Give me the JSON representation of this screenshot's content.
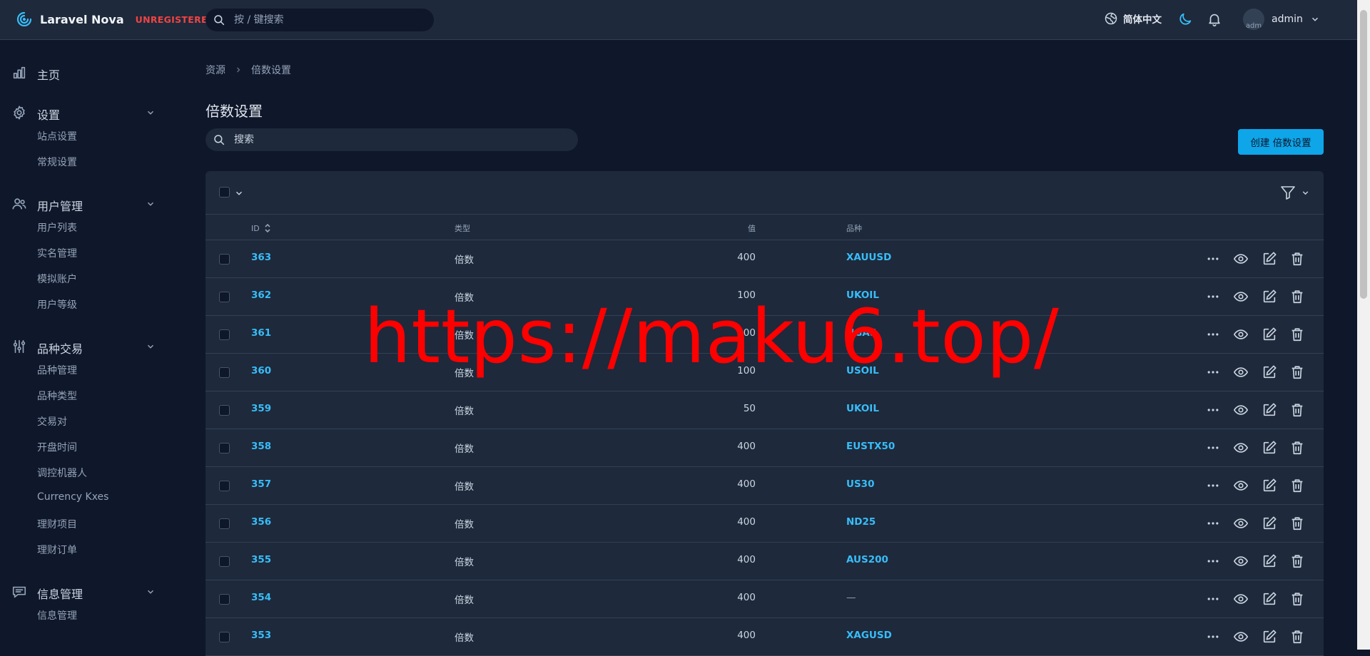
{
  "header": {
    "app_name": "Laravel Nova",
    "license_tag": "UNREGISTERED",
    "search_placeholder": "按 / 键搜索",
    "language": "简体中文",
    "user_name": "admin",
    "avatar_alt": "adm"
  },
  "sidebar": {
    "groups": [
      {
        "label": "主页",
        "icon": "chart-bar-icon",
        "items": []
      },
      {
        "label": "设置",
        "icon": "cog-icon",
        "items": [
          "站点设置",
          "常规设置"
        ]
      },
      {
        "label": "用户管理",
        "icon": "users-icon",
        "items": [
          "用户列表",
          "实名管理",
          "模拟账户",
          "用户等级"
        ]
      },
      {
        "label": "品种交易",
        "icon": "adjustments-icon",
        "items": [
          "品种管理",
          "品种类型",
          "交易对",
          "开盘时间",
          "调控机器人",
          "Currency Kxes",
          "理财项目",
          "理财订单"
        ]
      },
      {
        "label": "信息管理",
        "icon": "chat-icon",
        "items": [
          "信息管理"
        ]
      }
    ]
  },
  "breadcrumb": [
    "资源",
    "倍数设置"
  ],
  "page": {
    "title": "倍数设置",
    "search_placeholder": "搜索",
    "create_button": "创建 倍数设置"
  },
  "table": {
    "columns": {
      "id": "ID",
      "type": "类型",
      "value": "值",
      "variety": "品种"
    },
    "rows": [
      {
        "id": "363",
        "type": "倍数",
        "value": "400",
        "variety": "XAUUSD"
      },
      {
        "id": "362",
        "type": "倍数",
        "value": "100",
        "variety": "UKOIL"
      },
      {
        "id": "361",
        "type": "倍数",
        "value": "100",
        "variety": "NGAS"
      },
      {
        "id": "360",
        "type": "倍数",
        "value": "100",
        "variety": "USOIL"
      },
      {
        "id": "359",
        "type": "倍数",
        "value": "50",
        "variety": "UKOIL"
      },
      {
        "id": "358",
        "type": "倍数",
        "value": "400",
        "variety": "EUSTX50"
      },
      {
        "id": "357",
        "type": "倍数",
        "value": "400",
        "variety": "US30"
      },
      {
        "id": "356",
        "type": "倍数",
        "value": "400",
        "variety": "ND25"
      },
      {
        "id": "355",
        "type": "倍数",
        "value": "400",
        "variety": "AUS200"
      },
      {
        "id": "354",
        "type": "倍数",
        "value": "400",
        "variety": "—"
      },
      {
        "id": "353",
        "type": "倍数",
        "value": "400",
        "variety": "XAGUSD"
      }
    ]
  },
  "watermark": "https://maku6.top/",
  "colors": {
    "background": "#0f172a",
    "surface": "#1e293b",
    "accent": "#0ea5e9",
    "link": "#38bdf8",
    "danger": "#ef4444",
    "watermark": "#ff0000"
  }
}
